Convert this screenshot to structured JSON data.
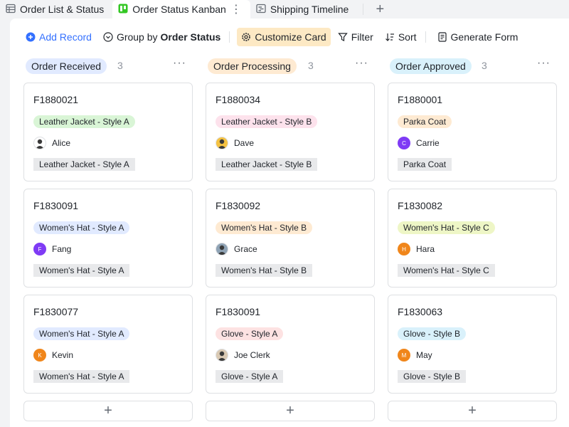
{
  "tabs": [
    {
      "label": "Order List & Status",
      "icon": "table-icon"
    },
    {
      "label": "Order Status Kanban",
      "icon": "kanban-icon",
      "active": true
    },
    {
      "label": "Shipping Timeline",
      "icon": "gantt-icon"
    }
  ],
  "tab_more": "⋮",
  "tab_add": "+",
  "toolbar": {
    "add_record": "Add Record",
    "group_by_prefix": "Group by",
    "group_by_field": "Order Status",
    "customize_card": "Customize Card",
    "filter": "Filter",
    "sort": "Sort",
    "generate_form": "Generate Form"
  },
  "colors": {
    "accent": "#3370ff",
    "highlight": "#fde9c4"
  },
  "columns": [
    {
      "title": "Order Received",
      "count": "3",
      "title_bg": "#e1eaff",
      "more": "···",
      "cards": [
        {
          "id": "F1880021",
          "tag": "Leather Jacket - Style A",
          "tag_bg": "#d9f5d6",
          "person": "Alice",
          "avatar_text": "",
          "avatar_color": "#ffffff",
          "avatar_kind": "photo-alice",
          "box": "Leather Jacket - Style A"
        },
        {
          "id": "F1830091",
          "tag": "Women's Hat - Style A",
          "tag_bg": "#e1eaff",
          "person": "Fang",
          "avatar_text": "F",
          "avatar_color": "#7f3bf5",
          "box": "Women's Hat - Style A"
        },
        {
          "id": "F1830077",
          "tag": "Women's Hat - Style A",
          "tag_bg": "#e1eaff",
          "person": "Kevin",
          "avatar_text": "K",
          "avatar_color": "#f0861b",
          "box": "Women's Hat - Style A"
        }
      ]
    },
    {
      "title": "Order Processing",
      "count": "3",
      "title_bg": "#feead2",
      "more": "···",
      "cards": [
        {
          "id": "F1880034",
          "tag": "Leather Jacket - Style B",
          "tag_bg": "#fde2ec",
          "person": "Dave",
          "avatar_text": "",
          "avatar_color": "#f5c242",
          "avatar_kind": "photo-dave",
          "box": "Leather Jacket - Style B"
        },
        {
          "id": "F1830092",
          "tag": "Women's Hat - Style B",
          "tag_bg": "#feead2",
          "person": "Grace",
          "avatar_text": "",
          "avatar_color": "#8fa3b5",
          "avatar_kind": "photo-grace",
          "box": "Women's Hat - Style B"
        },
        {
          "id": "F1830091",
          "tag": "Glove - Style A",
          "tag_bg": "#fde2e2",
          "person": "Joe Clerk",
          "avatar_text": "",
          "avatar_color": "#d9c9b3",
          "avatar_kind": "photo-joe",
          "box": "Glove - Style A"
        }
      ]
    },
    {
      "title": "Order Approved",
      "count": "3",
      "title_bg": "#d9f1fb",
      "more": "···",
      "cards": [
        {
          "id": "F1880001",
          "tag": "Parka Coat",
          "tag_bg": "#feead2",
          "person": "Carrie",
          "avatar_text": "C",
          "avatar_color": "#7f3bf5",
          "box": "Parka Coat"
        },
        {
          "id": "F1830082",
          "tag": "Women's Hat - Style C",
          "tag_bg": "#eef6c6",
          "person": "Hara",
          "avatar_text": "H",
          "avatar_color": "#f0861b",
          "box": "Women's Hat - Style C"
        },
        {
          "id": "F1830063",
          "tag": "Glove - Style B",
          "tag_bg": "#d9f1fb",
          "person": "May",
          "avatar_text": "M",
          "avatar_color": "#f0861b",
          "box": "Glove - Style B"
        }
      ]
    }
  ],
  "add_card": "+"
}
